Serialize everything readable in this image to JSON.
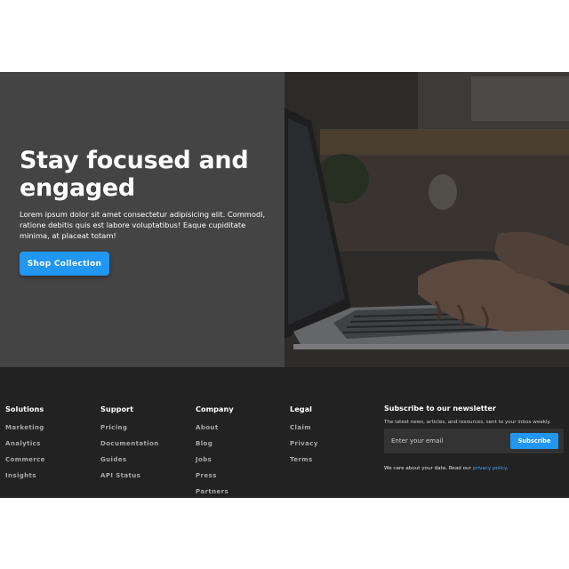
{
  "hero": {
    "title": "Stay focused and engaged",
    "text": "Lorem ipsum dolor sit amet consectetur adipisicing elit. Commodi, ratione debitis quis est labore voluptatibus! Eaque cupiditate minima, at placeat totam!",
    "button_label": "Shop Collection",
    "image_subject": "hands typing on laptop"
  },
  "footer": {
    "columns": [
      {
        "title": "Solutions",
        "links": [
          "Marketing",
          "Analytics",
          "Commerce",
          "Insights"
        ]
      },
      {
        "title": "Support",
        "links": [
          "Pricing",
          "Documentation",
          "Guides",
          "API Status"
        ]
      },
      {
        "title": "Company",
        "links": [
          "About",
          "Blog",
          "Jobs",
          "Press",
          "Partners"
        ]
      },
      {
        "title": "Legal",
        "links": [
          "Claim",
          "Privacy",
          "Terms"
        ]
      }
    ],
    "newsletter": {
      "title": "Subscribe to our newsletter",
      "subtitle": "The latest news, articles, and resources, sent to your inbox weekly.",
      "placeholder": "Enter your email",
      "button_label": "Subscribe",
      "note_prefix": "We care about your data. Read our ",
      "note_link": "privacy policy",
      "note_suffix": "."
    }
  },
  "colors": {
    "accent": "#2196f3",
    "hero_bg": "#444444",
    "footer_bg": "#222222"
  }
}
